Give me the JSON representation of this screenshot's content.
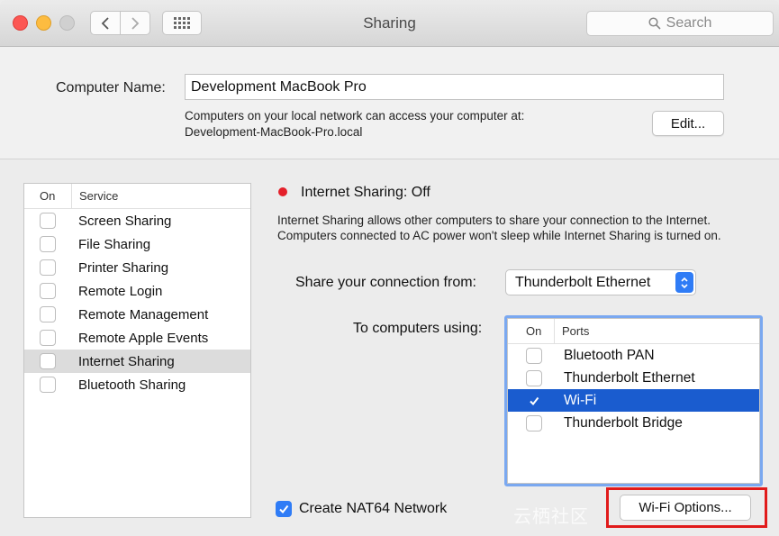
{
  "window": {
    "title": "Sharing",
    "search_placeholder": "Search"
  },
  "computer_name": {
    "label": "Computer Name:",
    "value": "Development MacBook Pro",
    "note_line1": "Computers on your local network can access your computer at:",
    "note_line2": "Development-MacBook-Pro.local",
    "edit_label": "Edit..."
  },
  "services": {
    "col_on": "On",
    "col_service": "Service",
    "items": [
      {
        "label": "Screen Sharing",
        "on": false
      },
      {
        "label": "File Sharing",
        "on": false
      },
      {
        "label": "Printer Sharing",
        "on": false
      },
      {
        "label": "Remote Login",
        "on": false
      },
      {
        "label": "Remote Management",
        "on": false
      },
      {
        "label": "Remote Apple Events",
        "on": false
      },
      {
        "label": "Internet Sharing",
        "on": false,
        "selected": true
      },
      {
        "label": "Bluetooth Sharing",
        "on": false
      }
    ]
  },
  "detail": {
    "status": "Internet Sharing: Off",
    "status_color": "#e4202a",
    "description": "Internet Sharing allows other computers to share your connection to the Internet. Computers connected to AC power won't sleep while Internet Sharing is turned on.",
    "share_from_label": "Share your connection from:",
    "share_from_value": "Thunderbolt Ethernet",
    "to_computers_label": "To computers using:",
    "ports_col_on": "On",
    "ports_col_ports": "Ports",
    "ports": [
      {
        "label": "Bluetooth PAN",
        "on": false
      },
      {
        "label": "Thunderbolt Ethernet",
        "on": false
      },
      {
        "label": "Wi-Fi",
        "on": true,
        "selected": true
      },
      {
        "label": "Thunderbolt Bridge",
        "on": false
      }
    ],
    "nat64_label": "Create NAT64 Network",
    "nat64_on": true,
    "wifi_options_label": "Wi-Fi Options..."
  },
  "watermark": "云栖社区",
  "colors": {
    "accent": "#2f7cf6",
    "selection": "#1a5ccf",
    "highlight": "#e11b1b"
  }
}
